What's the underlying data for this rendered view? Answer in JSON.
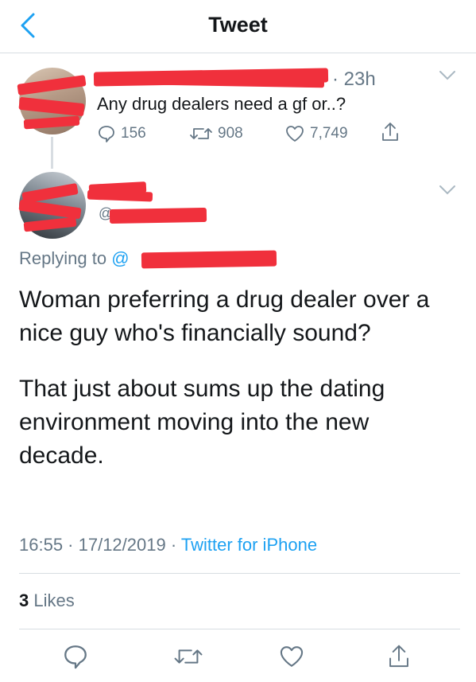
{
  "header": {
    "title": "Tweet"
  },
  "parent_tweet": {
    "time": "· 23h",
    "text": "Any drug dealers need a gf or..?",
    "replies": "156",
    "retweets": "908",
    "likes": "7,749"
  },
  "main_tweet": {
    "handle_prefix": "@",
    "replying_label": "Replying to ",
    "replying_at": "@",
    "paragraphs": [
      "Woman preferring a drug dealer over a nice guy who's financially sound?",
      "That just about sums up the dating environment moving into the new decade."
    ],
    "timestamp_time": "16:55 · 17/12/2019 · ",
    "source": "Twitter for iPhone",
    "likes_count": "3",
    "likes_label": "Likes"
  },
  "colors": {
    "accent": "#1da1f2",
    "secondary_text": "#657786",
    "redaction": "#f0303c"
  },
  "icons": {
    "back": "chevron-left-icon",
    "more": "chevron-down-icon",
    "reply": "speech-bubble-icon",
    "retweet": "retweet-icon",
    "like": "heart-icon",
    "share": "share-icon"
  }
}
